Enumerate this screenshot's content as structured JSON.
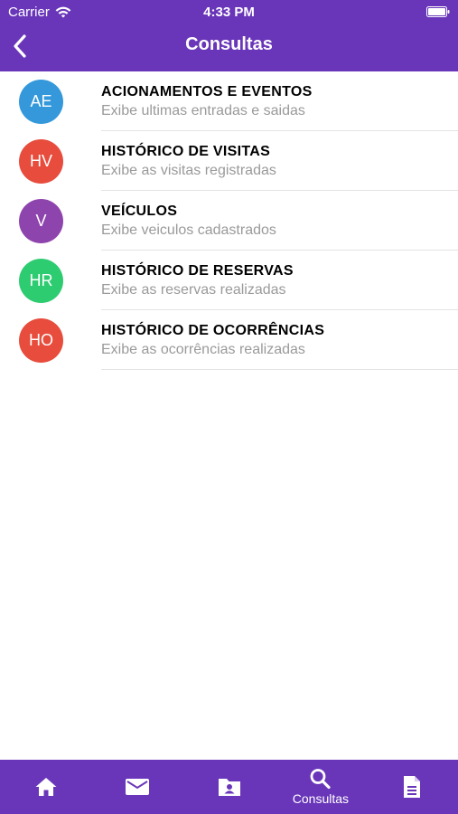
{
  "status_bar": {
    "carrier": "Carrier",
    "time": "4:33 PM"
  },
  "nav": {
    "title": "Consultas",
    "back_icon": "chevron-left-icon"
  },
  "items": [
    {
      "initials": "AE",
      "title": "ACIONAMENTOS E EVENTOS",
      "subtitle": "Exibe ultimas entradas e saidas",
      "color": "#3498db"
    },
    {
      "initials": "HV",
      "title": "HISTÓRICO DE VISITAS",
      "subtitle": "Exibe as visitas registradas",
      "color": "#e74c3c"
    },
    {
      "initials": "V",
      "title": "VEÍCULOS",
      "subtitle": "Exibe veiculos cadastrados",
      "color": "#8e44ad"
    },
    {
      "initials": "HR",
      "title": "HISTÓRICO DE RESERVAS",
      "subtitle": "Exibe as reservas realizadas",
      "color": "#2ecc71"
    },
    {
      "initials": "HO",
      "title": "HISTÓRICO DE OCORRÊNCIAS",
      "subtitle": "Exibe as ocorrências realizadas",
      "color": "#e74c3c"
    }
  ],
  "tabs": [
    {
      "icon": "home-icon",
      "label": ""
    },
    {
      "icon": "mail-icon",
      "label": ""
    },
    {
      "icon": "contact-folder-icon",
      "label": ""
    },
    {
      "icon": "search-icon",
      "label": "Consultas",
      "active": true
    },
    {
      "icon": "document-icon",
      "label": ""
    }
  ],
  "colors": {
    "brand": "#6936b9",
    "subtitle": "#9a9a9a",
    "separator": "#e3e3e3"
  }
}
